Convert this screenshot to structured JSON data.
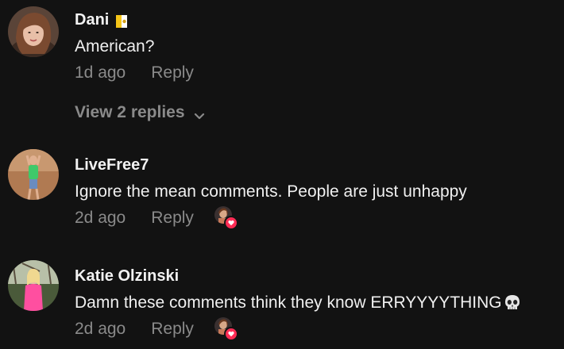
{
  "comments": [
    {
      "username": "Dani",
      "badge_icon": "flag-icon",
      "text": "American?",
      "timestamp": "1d ago",
      "reply_label": "Reply",
      "avatar_icon": "user-avatar",
      "view_replies_label": "View 2 replies",
      "view_replies_icon": "chevron-down-icon"
    },
    {
      "username": "LiveFree7",
      "text": "Ignore the mean comments. People are just unhappy",
      "timestamp": "2d ago",
      "reply_label": "Reply",
      "avatar_icon": "user-avatar",
      "liked_by_creator_icon": "creator-liked-heart-icon"
    },
    {
      "username": "Katie Olzinski",
      "text": "Damn these comments think they know ERRYYYYTHING",
      "trailing_emoji_icon": "skull-icon",
      "timestamp": "2d ago",
      "reply_label": "Reply",
      "avatar_icon": "user-avatar",
      "liked_by_creator_icon": "creator-liked-heart-icon"
    }
  ],
  "colors": {
    "background": "#121212",
    "primary_text": "#f0f0f0",
    "secondary_text": "#8a8a8a",
    "like_badge": "#fe2c55"
  }
}
